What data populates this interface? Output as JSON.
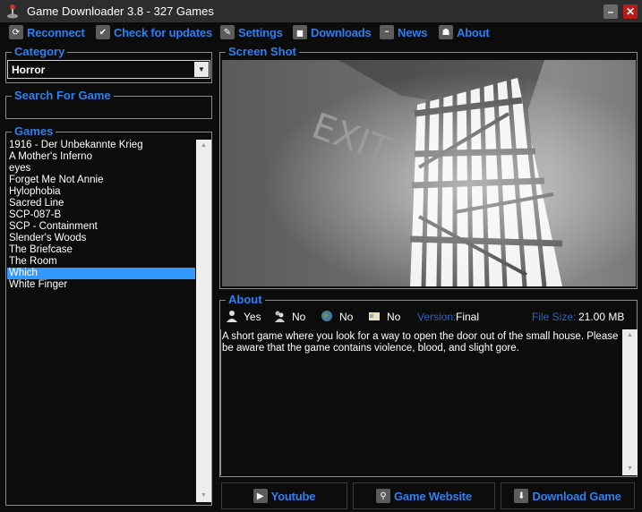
{
  "window": {
    "title": "Game Downloader 3.8 - 327 Games",
    "app_icon": "joystick-icon",
    "minimize_label": "–",
    "close_label": "✕"
  },
  "toolbar": {
    "items": [
      {
        "label": "Reconnect",
        "icon": "refresh-icon",
        "glyph": "⟳"
      },
      {
        "label": "Check for updates",
        "icon": "checkmark-icon",
        "glyph": "✔"
      },
      {
        "label": "Settings",
        "icon": "wrench-icon",
        "glyph": "✎"
      },
      {
        "label": "Downloads",
        "icon": "folder-icon",
        "glyph": "▆"
      },
      {
        "label": "News",
        "icon": "chat-bubble-icon",
        "glyph": "▪▪"
      },
      {
        "label": "About",
        "icon": "user-icon",
        "glyph": "☗"
      }
    ]
  },
  "category": {
    "title": "Category",
    "selected": "Horror",
    "arrow": "▼"
  },
  "search": {
    "title": "Search For Game",
    "value": ""
  },
  "games": {
    "title": "Games",
    "items": [
      "1916 - Der Unbekannte Krieg",
      "A Mother's Inferno",
      "eyes",
      "Forget Me Not Annie",
      "Hylophobia",
      "Sacred Line",
      "SCP-087-B",
      "SCP - Containment",
      "Slender's Woods",
      "The Briefcase",
      "The Room",
      "Which",
      "White Finger"
    ],
    "selected_index": 11
  },
  "screenshot": {
    "title": "Screen Shot",
    "caption": "EXIT"
  },
  "about": {
    "title": "About",
    "singleplayer": "Yes",
    "multiplayer": "No",
    "online": "No",
    "license": "No",
    "version_label": "Version:",
    "version": "Final",
    "filesize_label": "File Size:",
    "filesize": "21.00 MB",
    "description": "A short game where you look for a way to open the door out of the small house. Please be aware that the game contains violence, blood, and slight gore."
  },
  "buttons": {
    "youtube": "Youtube",
    "website": "Game Website",
    "download": "Download Game"
  },
  "scroll": {
    "up": "▲",
    "down": "▼"
  }
}
